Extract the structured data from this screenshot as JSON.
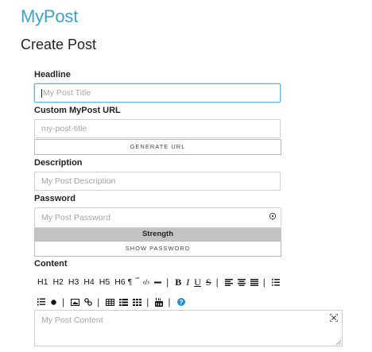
{
  "brand": "MyPost",
  "page_title": "Create Post",
  "fields": {
    "headline": {
      "label": "Headline",
      "placeholder": "My Post Title"
    },
    "url": {
      "label": "Custom MyPost URL",
      "placeholder": "my-post-title",
      "button": "GENERATE URL"
    },
    "description": {
      "label": "Description",
      "placeholder": "My Post Description"
    },
    "password": {
      "label": "Password",
      "placeholder": "My Post Password",
      "strength": "Strength",
      "show_button": "SHOW PASSWORD"
    },
    "content": {
      "label": "Content",
      "placeholder": "My Post Content"
    }
  },
  "toolbar": {
    "h1": "H1",
    "h2": "H2",
    "h3": "H3",
    "h4": "H4",
    "h5": "H5",
    "h6": "H6",
    "paragraph": "¶",
    "quote": "“”",
    "code": "‹/›",
    "bold": "B",
    "italic": "I",
    "underline": "U",
    "strike": "S"
  },
  "colors": {
    "brand": "#3ea3cc",
    "focus_border": "#69b7d8",
    "strength_bar": "#c3c3c3",
    "help_icon": "#2a8fd0"
  }
}
